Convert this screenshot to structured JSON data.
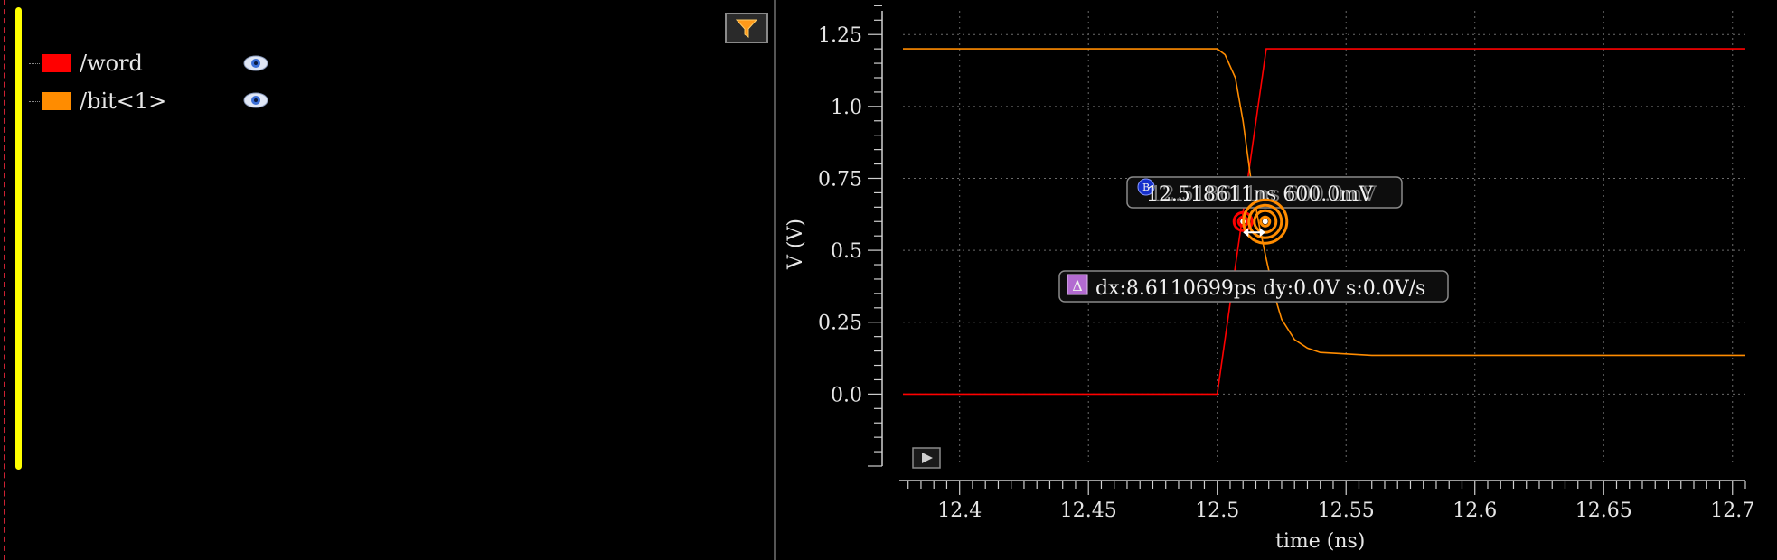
{
  "legend": {
    "items": [
      {
        "label": "/word",
        "color": "#ff0000",
        "icon": "eye-icon"
      },
      {
        "label": "/bit<1>",
        "color": "#ff8c00",
        "icon": "eye-icon"
      }
    ]
  },
  "toolbar": {
    "filter_icon": "filter-icon",
    "play_icon": "play-icon"
  },
  "markers": {
    "b_badge": "B",
    "b_label": "12.518611ns 600.0mV",
    "delta_badge": "Δ",
    "delta_label": "dx:8.6110699ps dy:0.0V s:0.0V/s"
  },
  "chart_data": {
    "type": "line",
    "xlabel": "time (ns)",
    "ylabel": "V (V)",
    "xlim": [
      12.378,
      12.705
    ],
    "ylim": [
      -0.25,
      1.37
    ],
    "x_ticks": [
      12.4,
      12.45,
      12.5,
      12.55,
      12.6,
      12.65,
      12.7
    ],
    "x_tick_labels": [
      "12.4",
      "12.45",
      "12.5",
      "12.55",
      "12.6",
      "12.65",
      "12.7"
    ],
    "y_ticks": [
      0.0,
      0.25,
      0.5,
      0.75,
      1.0,
      1.25
    ],
    "y_tick_labels": [
      "0.0",
      "0.25",
      "0.5",
      "0.75",
      "1.0",
      "1.25"
    ],
    "grid": true,
    "series": [
      {
        "name": "/word",
        "color": "#ff0000",
        "x": [
          12.378,
          12.5,
          12.519,
          12.705
        ],
        "y": [
          0.0,
          0.0,
          1.2,
          1.2
        ]
      },
      {
        "name": "/bit<1>",
        "color": "#ff8c00",
        "x": [
          12.378,
          12.5,
          12.503,
          12.507,
          12.51,
          12.513,
          12.516,
          12.519,
          12.522,
          12.525,
          12.53,
          12.535,
          12.54,
          12.55,
          12.56,
          12.705
        ],
        "y": [
          1.2,
          1.2,
          1.18,
          1.1,
          0.95,
          0.75,
          0.6,
          0.47,
          0.35,
          0.26,
          0.19,
          0.16,
          0.145,
          0.14,
          0.135,
          0.135
        ]
      }
    ],
    "cursor_points": [
      {
        "series": "/word",
        "x": 12.51,
        "y": 0.6
      },
      {
        "series": "/bit<1>",
        "x": 12.518611,
        "y": 0.6
      }
    ]
  }
}
